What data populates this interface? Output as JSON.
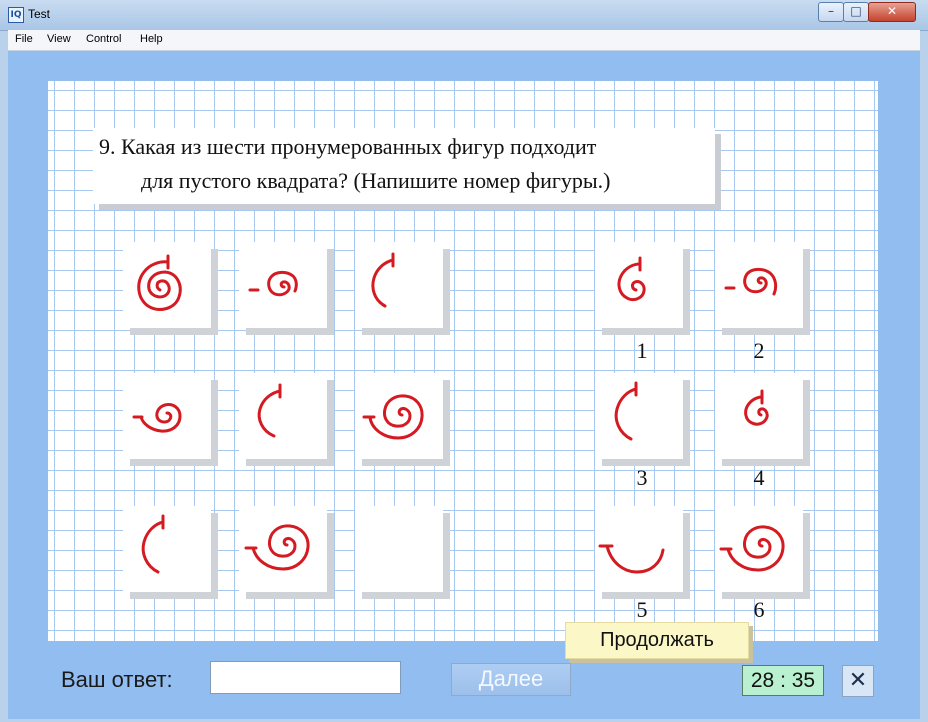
{
  "window": {
    "title": "Test",
    "app_icon": "IQ"
  },
  "menu": [
    "File",
    "View",
    "Control",
    "Help"
  ],
  "question": {
    "line1": "9.  Какая из шести пронумерованных фигур подходит",
    "line2": "для пустого квадрата? (Напишите номер фигуры.)"
  },
  "colors": {
    "figure": "#d41b22",
    "panel": "#92bdf0",
    "grid": "#a9c8ef"
  },
  "option_numbers": [
    "1",
    "2",
    "3",
    "4",
    "5",
    "6"
  ],
  "answer": {
    "label": "Ваш ответ:",
    "value": ""
  },
  "next_label": "Далее",
  "continue_label": "Продолжать",
  "timer": "28 : 35",
  "close_symbol": "✕"
}
